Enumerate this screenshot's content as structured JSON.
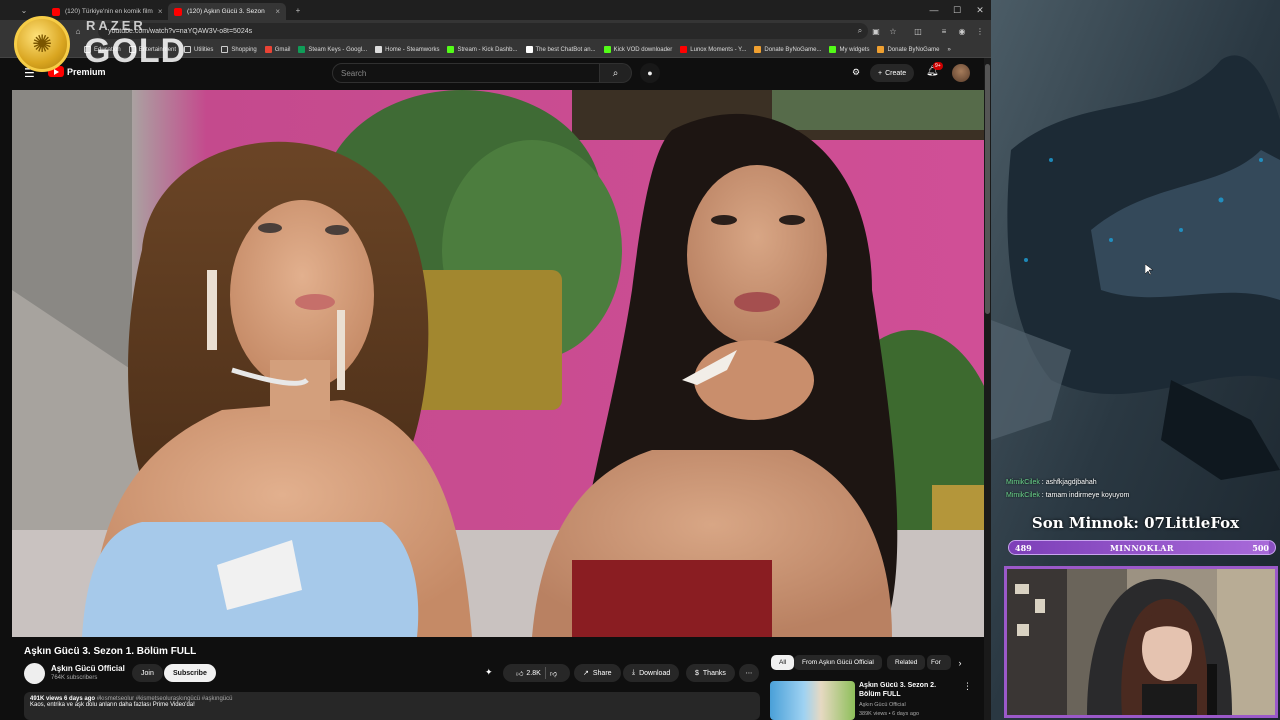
{
  "browser": {
    "tabs": [
      {
        "title": "(120) Türkiye'nin en komik film"
      },
      {
        "title": "(120) Aşkın Gücü 3. Sezon"
      }
    ],
    "url": "youtube.com/watch?v=naYQAW3V-o8t=5024s",
    "bookmarks": [
      "Education",
      "Entertainment",
      "Utilities",
      "Shopping",
      "Gmail",
      "Steam Keys - Googl...",
      "Home - Steamworks",
      "Stream - Kick Dashb...",
      "The best ChatBot an...",
      "Kick VOD downloader",
      "Lunox Moments - Y...",
      "Donate ByNoGame...",
      "My widgets",
      "Donate ByNoGame"
    ]
  },
  "overlay": {
    "brand": "RAZER",
    "tier": "GOLD"
  },
  "youtube": {
    "logo_text": "Premium",
    "search_placeholder": "Search",
    "create_label": "Create",
    "notif_badge": "9+"
  },
  "video": {
    "title": "Aşkın Gücü 3. Sezon 1. Bölüm FULL",
    "channel": "Aşkın Gücü Official",
    "subscribers": "764K subscribers",
    "join_label": "Join",
    "subscribe_label": "Subscribe",
    "likes": "2.8K",
    "share_label": "Share",
    "download_label": "Download",
    "thanks_label": "Thanks",
    "desc_meta": "491K views  6 days ago",
    "desc_tags": "#kısmetseolur #kismetseoluraşkıngücü #aşkıngücü",
    "desc_text": "Kaos, entrika ve aşk dolu anların daha fazlası Prime Video'da!"
  },
  "sidebar": {
    "chips": [
      "All",
      "From Aşkın Gücü Official",
      "Related",
      "For"
    ],
    "rec": {
      "title": "Aşkın Gücü 3. Sezon 2. Bölüm FULL",
      "channel": "Aşkın Gücü Official",
      "meta": "389K views • 6 days ago"
    }
  },
  "stream": {
    "chat": [
      {
        "user": "MimikCilek",
        "msg": "ashfkjagdjbahah"
      },
      {
        "user": "MimikCilek",
        "msg": "tamam indirmeye koyuyom"
      }
    ],
    "last_sub": "Son Minnok: 07LittleFox",
    "goal": {
      "current": "489",
      "label": "MINNOKLAR",
      "max": "500",
      "fraction": 0.978
    }
  }
}
